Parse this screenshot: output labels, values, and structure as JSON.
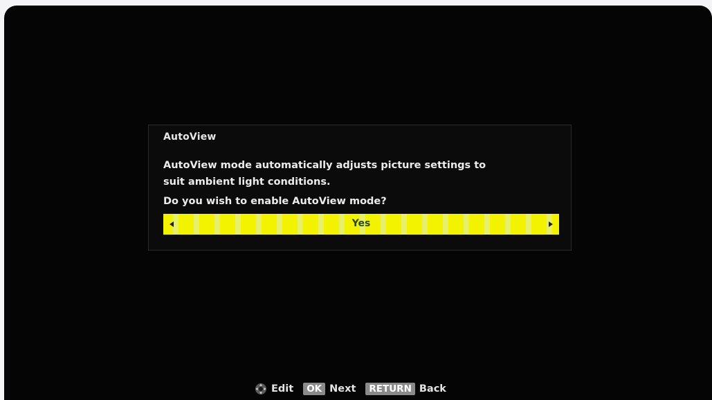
{
  "dialog": {
    "title": "AutoView",
    "description_line1": "AutoView mode automatically adjusts picture settings to",
    "description_line2": "suit ambient light conditions.",
    "question": "Do you wish to enable AutoView mode?",
    "selector": {
      "value": "Yes",
      "left_arrow_icon": "triangle-left-icon",
      "right_arrow_icon": "triangle-right-icon",
      "highlight_color": "#f3f300"
    }
  },
  "footer": {
    "edit_icon": "dpad-icon",
    "edit_label": "Edit",
    "ok_key": "OK",
    "next_label": "Next",
    "return_key": "RETURN",
    "back_label": "Back"
  }
}
